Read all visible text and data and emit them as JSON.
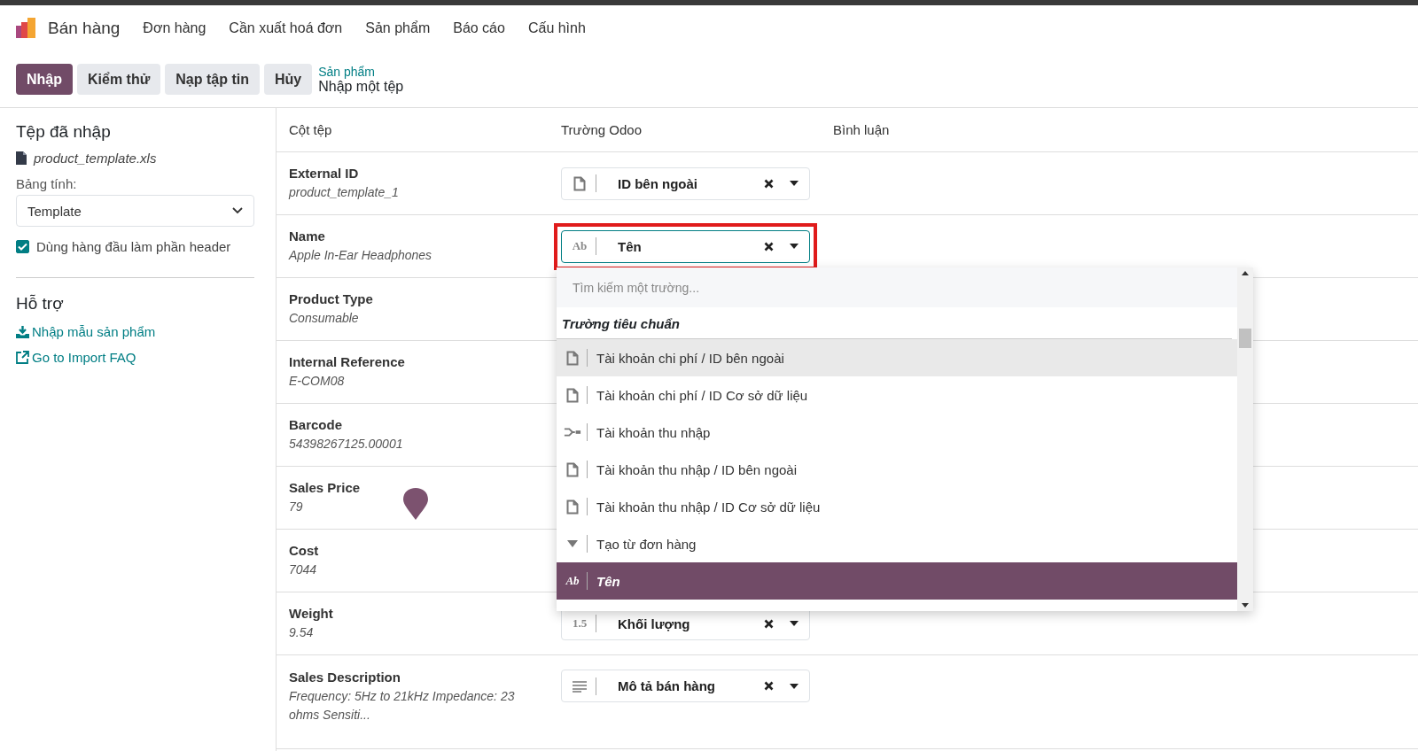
{
  "app": {
    "name": "Bán hàng",
    "menu": [
      "Đơn hàng",
      "Cần xuất hoá đơn",
      "Sản phẩm",
      "Báo cáo",
      "Cấu hình"
    ]
  },
  "actions": [
    {
      "label": "Nhập",
      "primary": true
    },
    {
      "label": "Kiểm thử",
      "primary": false
    },
    {
      "label": "Nạp tập tin",
      "primary": false
    },
    {
      "label": "Hủy",
      "primary": false
    }
  ],
  "breadcrumb": {
    "parent": "Sản phẩm",
    "current": "Nhập một tệp"
  },
  "sidebar": {
    "title": "Tệp đã nhập",
    "file": "product_template.xls",
    "sheet_label": "Bảng tính:",
    "sheet": "Template",
    "header_option": {
      "label": "Dùng hàng đầu làm phần header",
      "checked": true
    },
    "help_title": "Hỗ trợ",
    "links": [
      {
        "kind": "download",
        "label": "Nhập mẫu sản phẩm"
      },
      {
        "kind": "external",
        "label": "Go to Import FAQ"
      }
    ]
  },
  "table": {
    "columns": [
      "Cột tệp",
      "Trường Odoo",
      "Bình luận"
    ],
    "rows": [
      {
        "name": "External ID",
        "sample": "product_template_1",
        "field": {
          "kind": "file",
          "label": "ID bên ngoài",
          "annotated": false
        }
      },
      {
        "name": "Name",
        "sample": "Apple In-Ear Headphones",
        "field": {
          "kind": "glyph",
          "glyph": "Ab",
          "label": "Tên",
          "annotated": true
        }
      },
      {
        "name": "Product Type",
        "sample": "Consumable"
      },
      {
        "name": "Internal Reference",
        "sample": "E-COM08"
      },
      {
        "name": "Barcode",
        "sample": "54398267125.00001"
      },
      {
        "name": "Sales Price",
        "sample": "79"
      },
      {
        "name": "Cost",
        "sample": "7044"
      },
      {
        "name": "Weight",
        "sample": "9.54",
        "field": {
          "kind": "glyph",
          "glyph": "1.5",
          "label": "Khối lượng",
          "annotated": false
        }
      },
      {
        "name": "Sales Description",
        "sample": "Frequency: 5Hz to 21kHz Impedance: 23 ohms Sensiti...",
        "field": {
          "kind": "lines",
          "label": "Mô tả bán hàng",
          "annotated": false
        }
      }
    ]
  },
  "dropdown": {
    "placeholder": "Tìm kiếm một trường...",
    "group": "Trường tiêu chuẩn",
    "items": [
      {
        "kind": "file",
        "label": "Tài khoản chi phí / ID bên ngoài",
        "hovered": true,
        "selected": false
      },
      {
        "kind": "file",
        "label": "Tài khoản chi phí / ID Cơ sở dữ liệu",
        "hovered": false,
        "selected": false
      },
      {
        "kind": "relation",
        "label": "Tài khoản thu nhập",
        "hovered": false,
        "selected": false
      },
      {
        "kind": "file",
        "label": "Tài khoản thu nhập / ID bên ngoài",
        "hovered": false,
        "selected": false
      },
      {
        "kind": "file",
        "label": "Tài khoản thu nhập / ID Cơ sở dữ liệu",
        "hovered": false,
        "selected": false
      },
      {
        "kind": "selection",
        "label": "Tạo từ đơn hàng",
        "hovered": false,
        "selected": false
      },
      {
        "kind": "glyph",
        "glyph": "Ab",
        "label": "Tên",
        "hovered": false,
        "selected": true
      }
    ]
  }
}
